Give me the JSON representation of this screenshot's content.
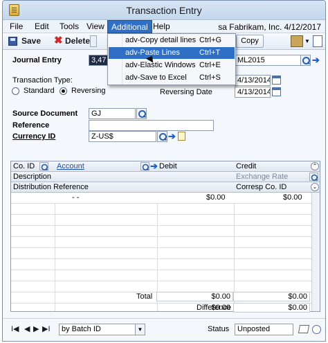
{
  "window": {
    "title": "Transaction Entry"
  },
  "menubar": {
    "items": [
      "File",
      "Edit",
      "Tools",
      "View",
      "Additional",
      "Help"
    ],
    "company": "sa  Fabrikam, Inc.  4/12/2017"
  },
  "toolbar": {
    "save_label": "Save",
    "delete_label": "Delete",
    "copy_label": "Copy"
  },
  "dropdown": {
    "items": [
      {
        "label": "adv-Copy detail lines",
        "shortcut": "Ctrl+G"
      },
      {
        "label": "adv-Paste Lines",
        "shortcut": "Ctrl+T"
      },
      {
        "label": "adv-Elastic Windows",
        "shortcut": "Ctrl+E"
      },
      {
        "label": "adv-Save to Excel",
        "shortcut": "Ctrl+S"
      }
    ]
  },
  "form": {
    "journal_entry_label": "Journal Entry",
    "journal_entry_value": "3,47",
    "batch_value": "ML2015",
    "transaction_type_label": "Transaction Type:",
    "standard_label": "Standard",
    "reversing_label": "Reversing",
    "transaction_date_value": "4/13/2014",
    "reversing_date_label": "Reversing Date",
    "reversing_date_value": "4/13/2014",
    "source_document_label": "Source Document",
    "source_document_value": "GJ",
    "reference_label": "Reference",
    "reference_value": "",
    "currency_id_label": "Currency ID",
    "currency_id_value": "Z-US$"
  },
  "grid": {
    "header1": [
      "Co. ID",
      "Account",
      "Debit",
      "Credit"
    ],
    "header2": [
      "Description",
      "Exchange Rate"
    ],
    "header3": [
      "Distribution Reference",
      "Corresp Co. ID"
    ],
    "first_row": {
      "account": "-        -",
      "debit": "$0.00",
      "credit": "$0.00"
    }
  },
  "totals": {
    "total_label": "Total",
    "total_debit": "$0.00",
    "total_credit": "$0.00",
    "difference_label": "Difference",
    "difference_debit": "$0.00",
    "difference_credit": "$0.00"
  },
  "statusbar": {
    "nav_first": "I◀",
    "nav_prev": "◀",
    "nav_next": "▶",
    "nav_last": "▶I",
    "sort_value": "by Batch ID",
    "status_label": "Status",
    "status_value": "Unposted"
  },
  "colors": {
    "menu_highlight": "#2f6fc6"
  }
}
